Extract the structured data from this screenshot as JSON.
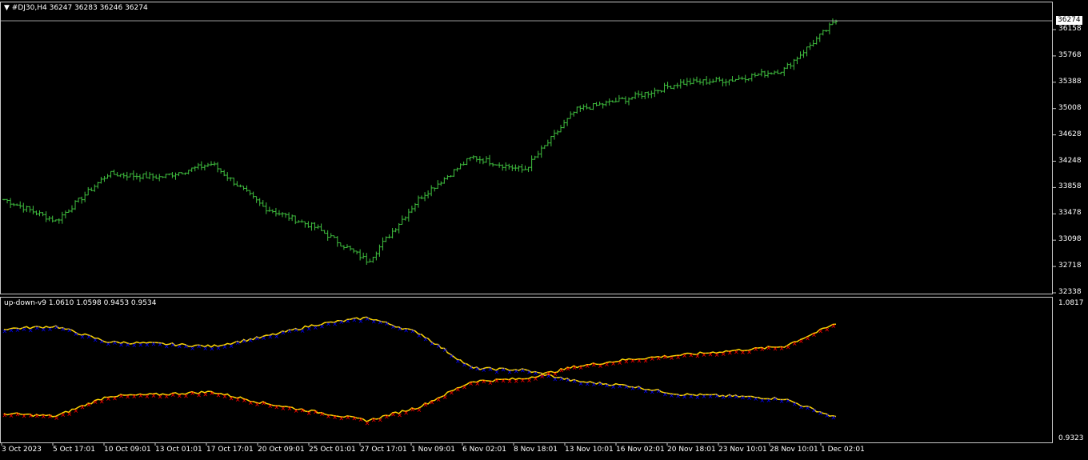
{
  "main_chart": {
    "symbol_arrow": "▼",
    "header": "#DJ30,H4  36247 36283 36246 36274",
    "current_price": "36274",
    "price_axis": [
      "36158",
      "35768",
      "35388",
      "35008",
      "34628",
      "34248",
      "33858",
      "33478",
      "33098",
      "32718",
      "32338"
    ],
    "bar_color": "#3fbf3f",
    "line_color": "#c8c8c8"
  },
  "indicator": {
    "header": "up-down-v9 1.0610 1.0598 0.9453 0.9534",
    "axis_top": "1.0817",
    "axis_bottom": "0.9323",
    "colors": {
      "line": "#ffd700",
      "up_marker": "#0000ff",
      "down_marker": "#ff0000"
    }
  },
  "time_axis": [
    "3 Oct 2023",
    "5 Oct 17:01",
    "10 Oct 09:01",
    "13 Oct 01:01",
    "17 Oct 17:01",
    "20 Oct 09:01",
    "25 Oct 01:01",
    "27 Oct 17:01",
    "1 Nov 09:01",
    "6 Nov 02:01",
    "8 Nov 18:01",
    "13 Nov 10:01",
    "16 Nov 02:01",
    "20 Nov 18:01",
    "23 Nov 10:01",
    "28 Nov 10:01",
    "1 Dec 02:01"
  ],
  "chart_data": [
    {
      "type": "ohlc",
      "title": "#DJ30,H4",
      "ylim": [
        32338,
        36300
      ],
      "x": [
        "3 Oct 2023",
        "5 Oct 17:01",
        "10 Oct 09:01",
        "13 Oct 01:01",
        "17 Oct 17:01",
        "20 Oct 09:01",
        "25 Oct 01:01",
        "27 Oct 17:01",
        "1 Nov 09:01",
        "6 Nov 02:01",
        "8 Nov 18:01",
        "13 Nov 10:01",
        "16 Nov 02:01",
        "20 Nov 18:01",
        "23 Nov 10:01",
        "28 Nov 10:01",
        "1 Dec 02:01"
      ],
      "close": [
        33620,
        33300,
        34000,
        33950,
        34150,
        33500,
        33200,
        32700,
        33650,
        34250,
        34050,
        34950,
        35120,
        35350,
        35400,
        35550,
        36274
      ]
    },
    {
      "type": "line",
      "title": "up-down-v9",
      "ylim": [
        0.9323,
        1.0817
      ],
      "x": [
        "3 Oct 2023",
        "5 Oct 17:01",
        "10 Oct 09:01",
        "13 Oct 01:01",
        "17 Oct 17:01",
        "20 Oct 09:01",
        "25 Oct 01:01",
        "27 Oct 17:01",
        "1 Nov 09:01",
        "6 Nov 02:01",
        "8 Nov 18:01",
        "13 Nov 10:01",
        "16 Nov 02:01",
        "20 Nov 18:01",
        "23 Nov 10:01",
        "28 Nov 10:01",
        "1 Dec 02:01"
      ],
      "series": [
        {
          "values": [
            1.055,
            1.058,
            1.04,
            1.038,
            1.035,
            1.046,
            1.06,
            1.068,
            1.05,
            1.01,
            1.008,
            0.995,
            0.99,
            0.98,
            0.978,
            0.975,
            0.9534
          ]
        },
        {
          "values": [
            0.958,
            0.955,
            0.978,
            0.98,
            0.983,
            0.97,
            0.96,
            0.95,
            0.966,
            0.995,
            0.998,
            1.012,
            1.02,
            1.025,
            1.03,
            1.035,
            1.061
          ]
        }
      ]
    }
  ]
}
